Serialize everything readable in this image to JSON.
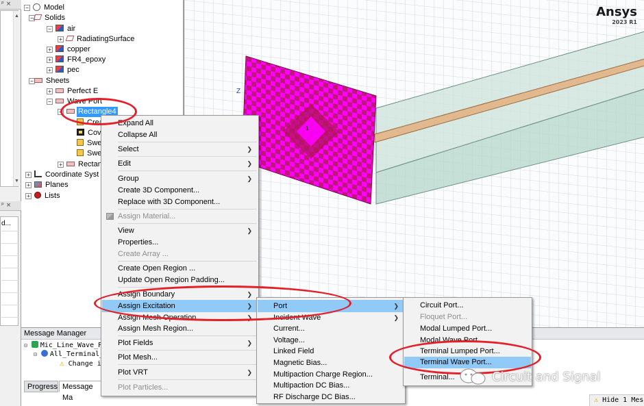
{
  "tree": {
    "model": "Model",
    "solids": "Solids",
    "air": "air",
    "radiating_surface": "RadiatingSurface",
    "copper": "copper",
    "fr4": "FR4_epoxy",
    "pec": "pec",
    "sheets": "Sheets",
    "perfect_e": "Perfect E",
    "wave_port": "Wave Port",
    "rectangle4": "Rectangle4",
    "create": "Crea",
    "cover": "Cov",
    "sweep1": "Swe",
    "sweep2": "Swe",
    "rectangle_other": "Rectan",
    "coordinate_systems": "Coordinate Syst",
    "planes": "Planes",
    "lists": "Lists"
  },
  "left_strip": {
    "pin1": "ᵖ ×",
    "pin2": "ᵖ ×",
    "field": "d..."
  },
  "viewport": {
    "brand": "Ansys",
    "version": "2023 R1",
    "axis_z": "Z",
    "port_label": "1"
  },
  "message_manager": {
    "title": "Message Manager",
    "row1": "Mic_Line_Wave_P",
    "row2": "All_Terminal_",
    "row3": "Change i"
  },
  "tabs": {
    "progress": "Progress",
    "message_manager": "Message Ma"
  },
  "status": {
    "hide_messages": "Hide 1 Mes"
  },
  "context_menu": {
    "expand_all": "Expand All",
    "collapse_all": "Collapse All",
    "select": "Select",
    "edit": "Edit",
    "group": "Group",
    "create_3d_component": "Create 3D Component...",
    "replace_3d_component": "Replace with 3D Component...",
    "assign_material": "Assign Material...",
    "view": "View",
    "properties": "Properties...",
    "create_array": "Create Array ...",
    "create_open_region": "Create Open Region ...",
    "update_open_region": "Update Open Region Padding...",
    "assign_boundary": "Assign Boundary",
    "assign_excitation": "Assign Excitation",
    "assign_mesh_operation": "Assign Mesh Operation",
    "assign_mesh_region": "Assign Mesh Region...",
    "plot_fields": "Plot Fields",
    "plot_mesh": "Plot Mesh...",
    "plot_vrt": "Plot VRT",
    "plot_particles": "Plot Particles..."
  },
  "excitation_menu": {
    "port": "Port",
    "incident_wave": "Incident Wave",
    "current": "Current...",
    "voltage": "Voltage...",
    "linked_field": "Linked Field",
    "magnetic_bias": "Magnetic Bias...",
    "multipaction_charge_region": "Multipaction Charge Region...",
    "multipaction_dc_bias": "Multipaction DC Bias...",
    "rf_discharge_dc_bias": "RF Discharge DC Bias..."
  },
  "port_menu": {
    "circuit_port": "Circuit Port...",
    "floquet_port": "Floquet Port...",
    "modal_lumped_port": "Modal Lumped Port...",
    "modal_wave_port": "Modal Wave Port...",
    "terminal_lumped_port": "Terminal Lumped Port...",
    "terminal_wave_port": "Terminal Wave Port...",
    "terminal_other": "Terminal..."
  },
  "watermark": {
    "text": "Circuit and Signal"
  },
  "colors": {
    "selection": "#3399ff",
    "menu_highlight": "#91c9f7",
    "annotation_red": "#e3202a",
    "port_magenta": "#ff00ff",
    "port_dark": "#b0125a",
    "substrate": "#cfe3dc"
  }
}
